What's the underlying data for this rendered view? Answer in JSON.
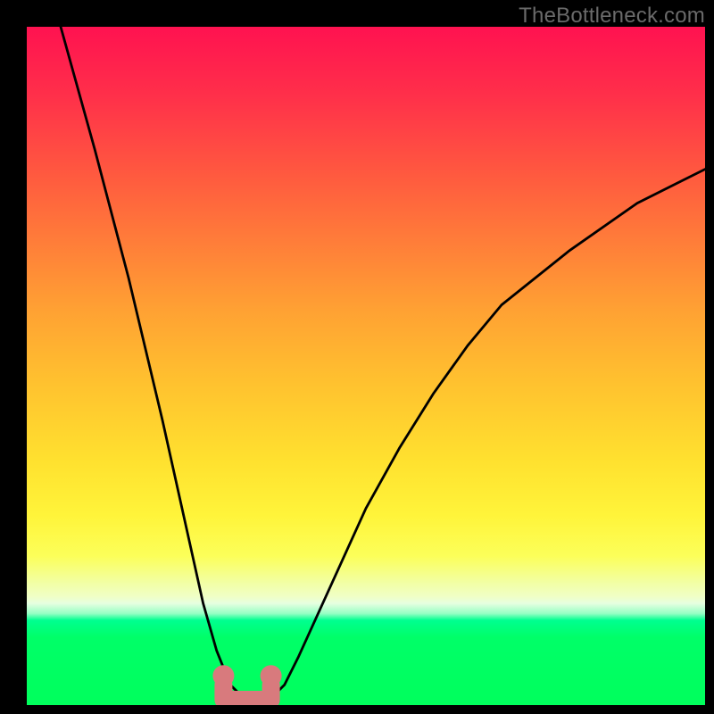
{
  "watermark": "TheBottleneck.com",
  "chart_data": {
    "type": "line",
    "title": "",
    "xlabel": "",
    "ylabel": "",
    "xlim": [
      0,
      100
    ],
    "ylim": [
      0,
      100
    ],
    "grid": false,
    "legend": false,
    "series": [
      {
        "name": "bottleneck-curve",
        "x": [
          5,
          10,
          15,
          20,
          22,
          24,
          26,
          28,
          30,
          32,
          33,
          34,
          36,
          38,
          40,
          45,
          50,
          55,
          60,
          65,
          70,
          80,
          90,
          100
        ],
        "values": [
          100,
          82,
          63,
          42,
          33,
          24,
          15,
          8,
          3,
          1,
          0,
          0,
          1,
          3,
          7,
          18,
          29,
          38,
          46,
          53,
          59,
          67,
          74,
          79
        ]
      }
    ],
    "markers": [
      {
        "name": "left-bound-marker",
        "x": 29,
        "y": 3
      },
      {
        "name": "right-bound-marker",
        "x": 36,
        "y": 3
      }
    ],
    "valley_range_x": [
      30,
      35
    ],
    "gradient_stops_pct": {
      "red_magenta": 0,
      "orange": 40,
      "yellow": 72,
      "pale": 84,
      "green": 90
    }
  }
}
